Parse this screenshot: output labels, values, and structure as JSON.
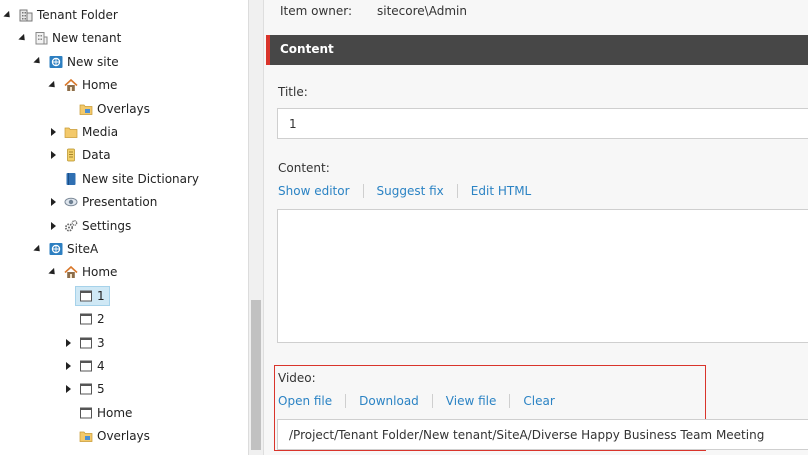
{
  "tree": {
    "items": [
      {
        "label": "Tenant Folder",
        "icon": "tenant-folder-icon",
        "level": 0,
        "expander": "down"
      },
      {
        "label": "New tenant",
        "icon": "tenant-icon",
        "level": 1,
        "expander": "down"
      },
      {
        "label": "New site",
        "icon": "site-icon",
        "level": 2,
        "expander": "down"
      },
      {
        "label": "Home",
        "icon": "home-icon",
        "level": 3,
        "expander": "down"
      },
      {
        "label": "Overlays",
        "icon": "folder-icon",
        "level": 4,
        "expander": "none"
      },
      {
        "label": "Media",
        "icon": "media-folder-icon",
        "level": 3,
        "expander": "right"
      },
      {
        "label": "Data",
        "icon": "data-icon",
        "level": 3,
        "expander": "right"
      },
      {
        "label": "New site Dictionary",
        "icon": "dictionary-icon",
        "level": 3,
        "expander": "none"
      },
      {
        "label": "Presentation",
        "icon": "presentation-icon",
        "level": 3,
        "expander": "right"
      },
      {
        "label": "Settings",
        "icon": "settings-icon",
        "level": 3,
        "expander": "right"
      },
      {
        "label": "SiteA",
        "icon": "site-icon",
        "level": 2,
        "expander": "down"
      },
      {
        "label": "Home",
        "icon": "home-icon",
        "level": 3,
        "expander": "down"
      },
      {
        "label": "1",
        "icon": "page-icon",
        "level": 4,
        "expander": "none",
        "selected": true
      },
      {
        "label": "2",
        "icon": "page-icon",
        "level": 4,
        "expander": "none"
      },
      {
        "label": "3",
        "icon": "page-icon",
        "level": 4,
        "expander": "right"
      },
      {
        "label": "4",
        "icon": "page-icon",
        "level": 4,
        "expander": "right"
      },
      {
        "label": "5",
        "icon": "page-icon",
        "level": 4,
        "expander": "right"
      },
      {
        "label": "Home",
        "icon": "page-icon",
        "level": 4,
        "expander": "none"
      },
      {
        "label": "Overlays",
        "icon": "folder-icon",
        "level": 4,
        "expander": "none"
      }
    ]
  },
  "editor": {
    "item_owner_label": "Item owner:",
    "item_owner_value": "sitecore\\Admin",
    "section_title": "Content",
    "title_label": "Title:",
    "title_value": "1",
    "content_label": "Content:",
    "content_links": [
      "Show editor",
      "Suggest fix",
      "Edit HTML"
    ],
    "video_label": "Video:",
    "video_links": [
      "Open file",
      "Download",
      "View file",
      "Clear"
    ],
    "video_value": "/Project/Tenant Folder/New tenant/SiteA/Diverse Happy Business Team Meeting"
  },
  "colors": {
    "link": "#2b83c4",
    "section_header": "#474747",
    "accent_red": "#d9342b",
    "selection": "#cfe8f5"
  }
}
